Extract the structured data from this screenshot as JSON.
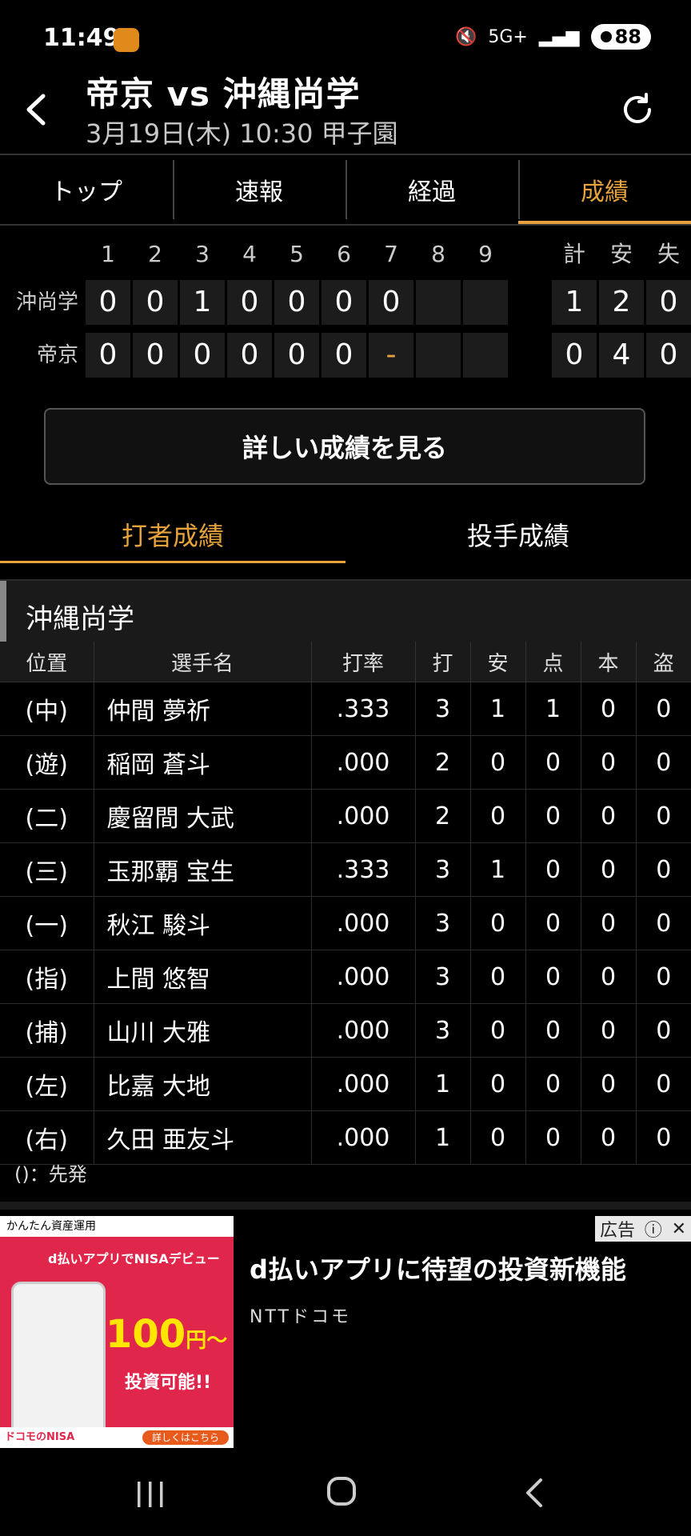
{
  "status_bar": {
    "time": "11:49",
    "network": "5G+",
    "battery": "88"
  },
  "header": {
    "title": "帝京 vs 沖縄尚学",
    "subtitle": "3月19日(木) 10:30 甲子園"
  },
  "tabs": [
    {
      "label": "トップ"
    },
    {
      "label": "速報"
    },
    {
      "label": "経過"
    },
    {
      "label": "成績",
      "active": true
    }
  ],
  "scoreboard": {
    "innings": [
      "1",
      "2",
      "3",
      "4",
      "5",
      "6",
      "7",
      "8",
      "9"
    ],
    "total_headers": [
      "計",
      "安",
      "失"
    ],
    "teams": [
      {
        "name": "沖尚学",
        "innings": [
          "0",
          "0",
          "1",
          "0",
          "0",
          "0",
          "0",
          "",
          ""
        ],
        "totals": [
          "1",
          "2",
          "0"
        ]
      },
      {
        "name": "帝京",
        "innings": [
          "0",
          "0",
          "0",
          "0",
          "0",
          "0",
          "-",
          "",
          ""
        ],
        "totals": [
          "0",
          "4",
          "0"
        ]
      }
    ]
  },
  "detail_button": {
    "label": "詳しい成績を見る"
  },
  "sub_tabs": [
    {
      "label": "打者成績",
      "active": true
    },
    {
      "label": "投手成績"
    }
  ],
  "team_section": {
    "name": "沖縄尚学",
    "columns": [
      "位置",
      "選手名",
      "打率",
      "打",
      "安",
      "点",
      "本",
      "盗"
    ],
    "rows": [
      [
        "(中)",
        "仲間 夢祈",
        ".333",
        "3",
        "1",
        "1",
        "0",
        "0"
      ],
      [
        "(遊)",
        "稲岡 蒼斗",
        ".000",
        "2",
        "0",
        "0",
        "0",
        "0"
      ],
      [
        "(二)",
        "慶留間 大武",
        ".000",
        "2",
        "0",
        "0",
        "0",
        "0"
      ],
      [
        "(三)",
        "玉那覇 宝生",
        ".333",
        "3",
        "1",
        "0",
        "0",
        "0"
      ],
      [
        "(一)",
        "秋江 駿斗",
        ".000",
        "3",
        "0",
        "0",
        "0",
        "0"
      ],
      [
        "(指)",
        "上間 悠智",
        ".000",
        "3",
        "0",
        "0",
        "0",
        "0"
      ],
      [
        "(捕)",
        "山川 大雅",
        ".000",
        "3",
        "0",
        "0",
        "0",
        "0"
      ],
      [
        "(左)",
        "比嘉 大地",
        ".000",
        "1",
        "0",
        "0",
        "0",
        "0"
      ],
      [
        "(右)",
        "久田 亜友斗",
        ".000",
        "1",
        "0",
        "0",
        "0",
        "0"
      ]
    ],
    "note": "()：先発"
  },
  "ad": {
    "badge": "広告",
    "image_top": "かんたん資産運用",
    "image_tagline": "d払いアプリでNISAデビュー",
    "image_amount": "100",
    "image_yen": "円〜",
    "image_invest": "投資可能!!",
    "image_bottom": "ドコモのNISA",
    "image_more": "詳しくはこちら",
    "headline": "d払いアプリに待望の投資新機能",
    "brand": "NTTドコモ"
  }
}
